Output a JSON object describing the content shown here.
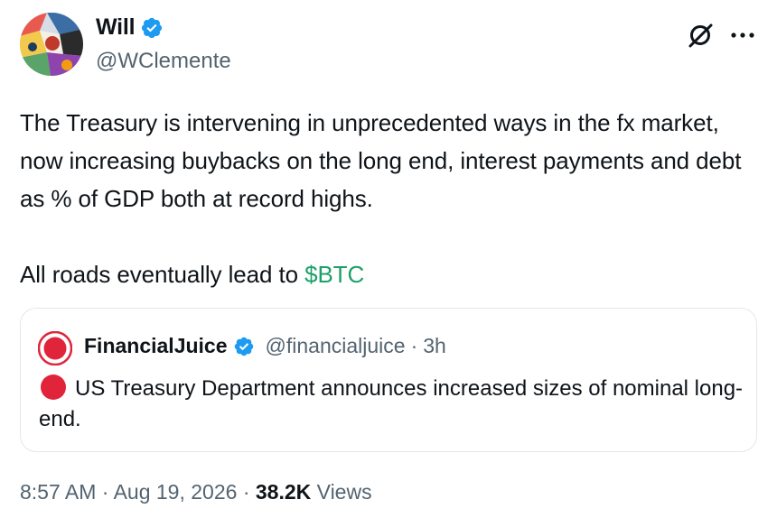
{
  "author": {
    "display_name": "Will",
    "handle": "@WClemente",
    "verified": true
  },
  "tweet": {
    "paragraph_1": "The Treasury is intervening in unprecedented ways in the fx market, now increasing buybacks on the long end, interest payments and debt as % of GDP both at record highs.",
    "paragraph_2_prefix": "All roads eventually lead to ",
    "cashtag": "$BTC"
  },
  "quote": {
    "display_name": "FinancialJuice",
    "handle": "@financialjuice",
    "separator": "·",
    "time": "3h",
    "verified": true,
    "text": "US Treasury Department announces increased sizes of nominal long-end."
  },
  "meta": {
    "time": "8:57 AM",
    "separator": "·",
    "date": "Aug 19, 2026",
    "views_count": "38.2K",
    "views_label": "Views"
  },
  "colors": {
    "cashtag": "#1ca06a",
    "verified": "#1d9bf0",
    "alert_red": "#e0243a",
    "secondary_text": "#536471"
  },
  "icons": {
    "verified": "verified-badge-icon",
    "grok": "grok-icon",
    "more": "more-options-icon",
    "alert": "red-circle-icon"
  }
}
